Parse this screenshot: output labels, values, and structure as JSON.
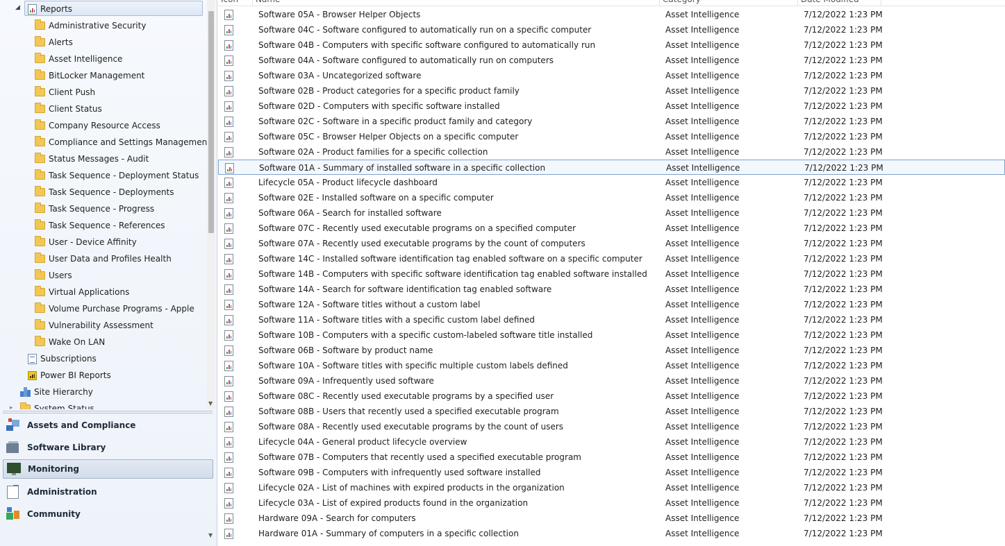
{
  "nav": {
    "tree": {
      "reports": "Reports",
      "folders": [
        "Administrative Security",
        "Alerts",
        "Asset Intelligence",
        "BitLocker Management",
        "Client Push",
        "Client Status",
        "Company Resource Access",
        "Compliance and Settings Management",
        "Status Messages - Audit",
        "Task Sequence - Deployment Status",
        "Task Sequence - Deployments",
        "Task Sequence - Progress",
        "Task Sequence - References",
        "User - Device Affinity",
        "User Data and Profiles Health",
        "Users",
        "Virtual Applications",
        "Volume Purchase Programs - Apple",
        "Vulnerability Assessment",
        "Wake On LAN"
      ],
      "subscriptions": "Subscriptions",
      "power_bi": "Power BI Reports",
      "site_hierarchy": "Site Hierarchy",
      "system_status": "System Status"
    },
    "workspaces": [
      {
        "label": "Assets and Compliance",
        "icon": "assets-and-compliance-icon"
      },
      {
        "label": "Software Library",
        "icon": "software-library-icon"
      },
      {
        "label": "Monitoring",
        "icon": "monitoring-icon"
      },
      {
        "label": "Administration",
        "icon": "administration-icon"
      },
      {
        "label": "Community",
        "icon": "community-icon"
      }
    ],
    "selected_workspace": "Monitoring"
  },
  "list": {
    "columns": [
      "Icon",
      "Name",
      "Category",
      "Date Modified"
    ],
    "selected_row": "Software 01A - Summary of installed software in a specific collection",
    "rows": [
      {
        "name": "Software 05A - Browser Helper Objects",
        "category": "Asset Intelligence",
        "date": "7/12/2022 1:23 PM"
      },
      {
        "name": "Software 04C - Software configured to automatically run on a specific computer",
        "category": "Asset Intelligence",
        "date": "7/12/2022 1:23 PM"
      },
      {
        "name": "Software 04B - Computers with specific software configured to automatically run",
        "category": "Asset Intelligence",
        "date": "7/12/2022 1:23 PM"
      },
      {
        "name": "Software 04A - Software configured to automatically run on computers",
        "category": "Asset Intelligence",
        "date": "7/12/2022 1:23 PM"
      },
      {
        "name": "Software 03A - Uncategorized software",
        "category": "Asset Intelligence",
        "date": "7/12/2022 1:23 PM"
      },
      {
        "name": "Software 02B - Product categories for a specific product family",
        "category": "Asset Intelligence",
        "date": "7/12/2022 1:23 PM"
      },
      {
        "name": "Software 02D - Computers with specific software installed",
        "category": "Asset Intelligence",
        "date": "7/12/2022 1:23 PM"
      },
      {
        "name": "Software 02C - Software in a specific product family and category",
        "category": "Asset Intelligence",
        "date": "7/12/2022 1:23 PM"
      },
      {
        "name": "Software 05C - Browser Helper Objects on a specific computer",
        "category": "Asset Intelligence",
        "date": "7/12/2022 1:23 PM"
      },
      {
        "name": "Software 02A - Product families for a specific collection",
        "category": "Asset Intelligence",
        "date": "7/12/2022 1:23 PM"
      },
      {
        "name": "Software 01A - Summary of installed software in a specific collection",
        "category": "Asset Intelligence",
        "date": "7/12/2022 1:23 PM"
      },
      {
        "name": "Lifecycle 05A - Product lifecycle dashboard",
        "category": "Asset Intelligence",
        "date": "7/12/2022 1:23 PM"
      },
      {
        "name": "Software 02E - Installed software on a specific computer",
        "category": "Asset Intelligence",
        "date": "7/12/2022 1:23 PM"
      },
      {
        "name": "Software 06A - Search for installed software",
        "category": "Asset Intelligence",
        "date": "7/12/2022 1:23 PM"
      },
      {
        "name": "Software 07C - Recently used executable programs on a specified computer",
        "category": "Asset Intelligence",
        "date": "7/12/2022 1:23 PM"
      },
      {
        "name": "Software 07A - Recently used executable programs by the count of computers",
        "category": "Asset Intelligence",
        "date": "7/12/2022 1:23 PM"
      },
      {
        "name": "Software 14C - Installed software identification tag enabled software on a specific computer",
        "category": "Asset Intelligence",
        "date": "7/12/2022 1:23 PM"
      },
      {
        "name": "Software 14B - Computers with specific software identification tag enabled software installed",
        "category": "Asset Intelligence",
        "date": "7/12/2022 1:23 PM"
      },
      {
        "name": "Software 14A - Search for software identification tag enabled software",
        "category": "Asset Intelligence",
        "date": "7/12/2022 1:23 PM"
      },
      {
        "name": "Software 12A - Software titles without a custom label",
        "category": "Asset Intelligence",
        "date": "7/12/2022 1:23 PM"
      },
      {
        "name": "Software 11A - Software titles with a specific custom label defined",
        "category": "Asset Intelligence",
        "date": "7/12/2022 1:23 PM"
      },
      {
        "name": "Software 10B - Computers with a specific custom-labeled software title installed",
        "category": "Asset Intelligence",
        "date": "7/12/2022 1:23 PM"
      },
      {
        "name": "Software 06B - Software by product name",
        "category": "Asset Intelligence",
        "date": "7/12/2022 1:23 PM"
      },
      {
        "name": "Software 10A - Software titles with specific multiple custom labels defined",
        "category": "Asset Intelligence",
        "date": "7/12/2022 1:23 PM"
      },
      {
        "name": "Software 09A - Infrequently used software",
        "category": "Asset Intelligence",
        "date": "7/12/2022 1:23 PM"
      },
      {
        "name": "Software 08C - Recently used executable programs by a specified user",
        "category": "Asset Intelligence",
        "date": "7/12/2022 1:23 PM"
      },
      {
        "name": "Software 08B - Users that recently used a specified executable program",
        "category": "Asset Intelligence",
        "date": "7/12/2022 1:23 PM"
      },
      {
        "name": "Software 08A - Recently used executable programs by the count of users",
        "category": "Asset Intelligence",
        "date": "7/12/2022 1:23 PM"
      },
      {
        "name": "Lifecycle 04A - General product lifecycle overview",
        "category": "Asset Intelligence",
        "date": "7/12/2022 1:23 PM"
      },
      {
        "name": "Software 07B - Computers that recently used a specified executable program",
        "category": "Asset Intelligence",
        "date": "7/12/2022 1:23 PM"
      },
      {
        "name": "Software 09B - Computers with infrequently used software installed",
        "category": "Asset Intelligence",
        "date": "7/12/2022 1:23 PM"
      },
      {
        "name": "Lifecycle 02A - List of machines with expired products in the organization",
        "category": "Asset Intelligence",
        "date": "7/12/2022 1:23 PM"
      },
      {
        "name": "Lifecycle 03A - List of expired products found in the organization",
        "category": "Asset Intelligence",
        "date": "7/12/2022 1:23 PM"
      },
      {
        "name": "Hardware 09A - Search for computers",
        "category": "Asset Intelligence",
        "date": "7/12/2022 1:23 PM"
      },
      {
        "name": "Hardware 01A - Summary of computers in a specific collection",
        "category": "Asset Intelligence",
        "date": "7/12/2022 1:23 PM"
      }
    ]
  }
}
